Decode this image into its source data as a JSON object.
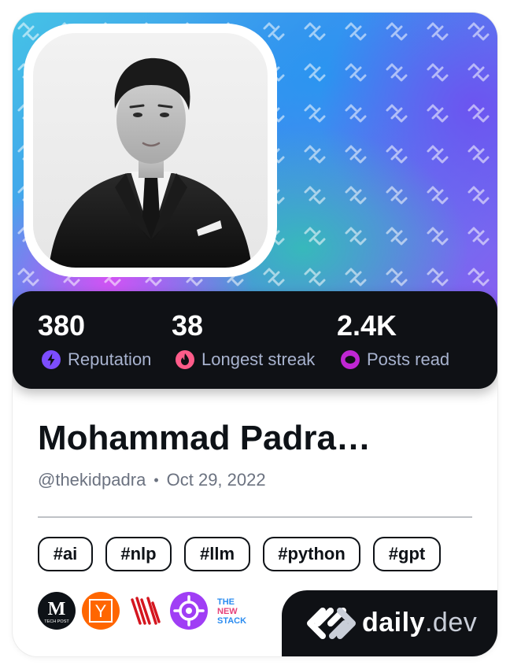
{
  "profile": {
    "name": "Mohammad Padra…",
    "username": "@thekidpadra",
    "separator": "•",
    "joined": "Oct 29, 2022",
    "avatar_description_icon": "profile-photo"
  },
  "stats": [
    {
      "value": "380",
      "label": "Reputation",
      "icon": "reputation-bolt-icon",
      "color": "#7c4dff"
    },
    {
      "value": "38",
      "label": "Longest streak",
      "icon": "streak-flame-icon",
      "color": "#ff5c8a"
    },
    {
      "value": "2.4K",
      "label": "Posts read",
      "icon": "posts-read-ring-icon",
      "color": "#c026d3"
    }
  ],
  "tags": [
    "#ai",
    "#nlp",
    "#llm",
    "#python",
    "#gpt"
  ],
  "sources": [
    {
      "name": "tech-post-source-icon",
      "text_top": "M",
      "text_bottom": "TECH POST",
      "color": "#0e1217"
    },
    {
      "name": "hacker-news-source-icon",
      "text_top": "Y",
      "color": "#ff6600"
    },
    {
      "name": "red-stripes-source-icon",
      "color": "#d4161f"
    },
    {
      "name": "crosshair-source-icon",
      "color": "#a03ef5"
    },
    {
      "name": "the-new-stack-source-icon",
      "lines": [
        "THE",
        "NEW",
        "STACK"
      ],
      "colors": [
        "#2b8cf0",
        "#e6427a",
        "#2b8cf0"
      ]
    }
  ],
  "brand": {
    "name": "daily",
    "suffix": ".dev",
    "icon": "daily-dev-logo-icon"
  }
}
